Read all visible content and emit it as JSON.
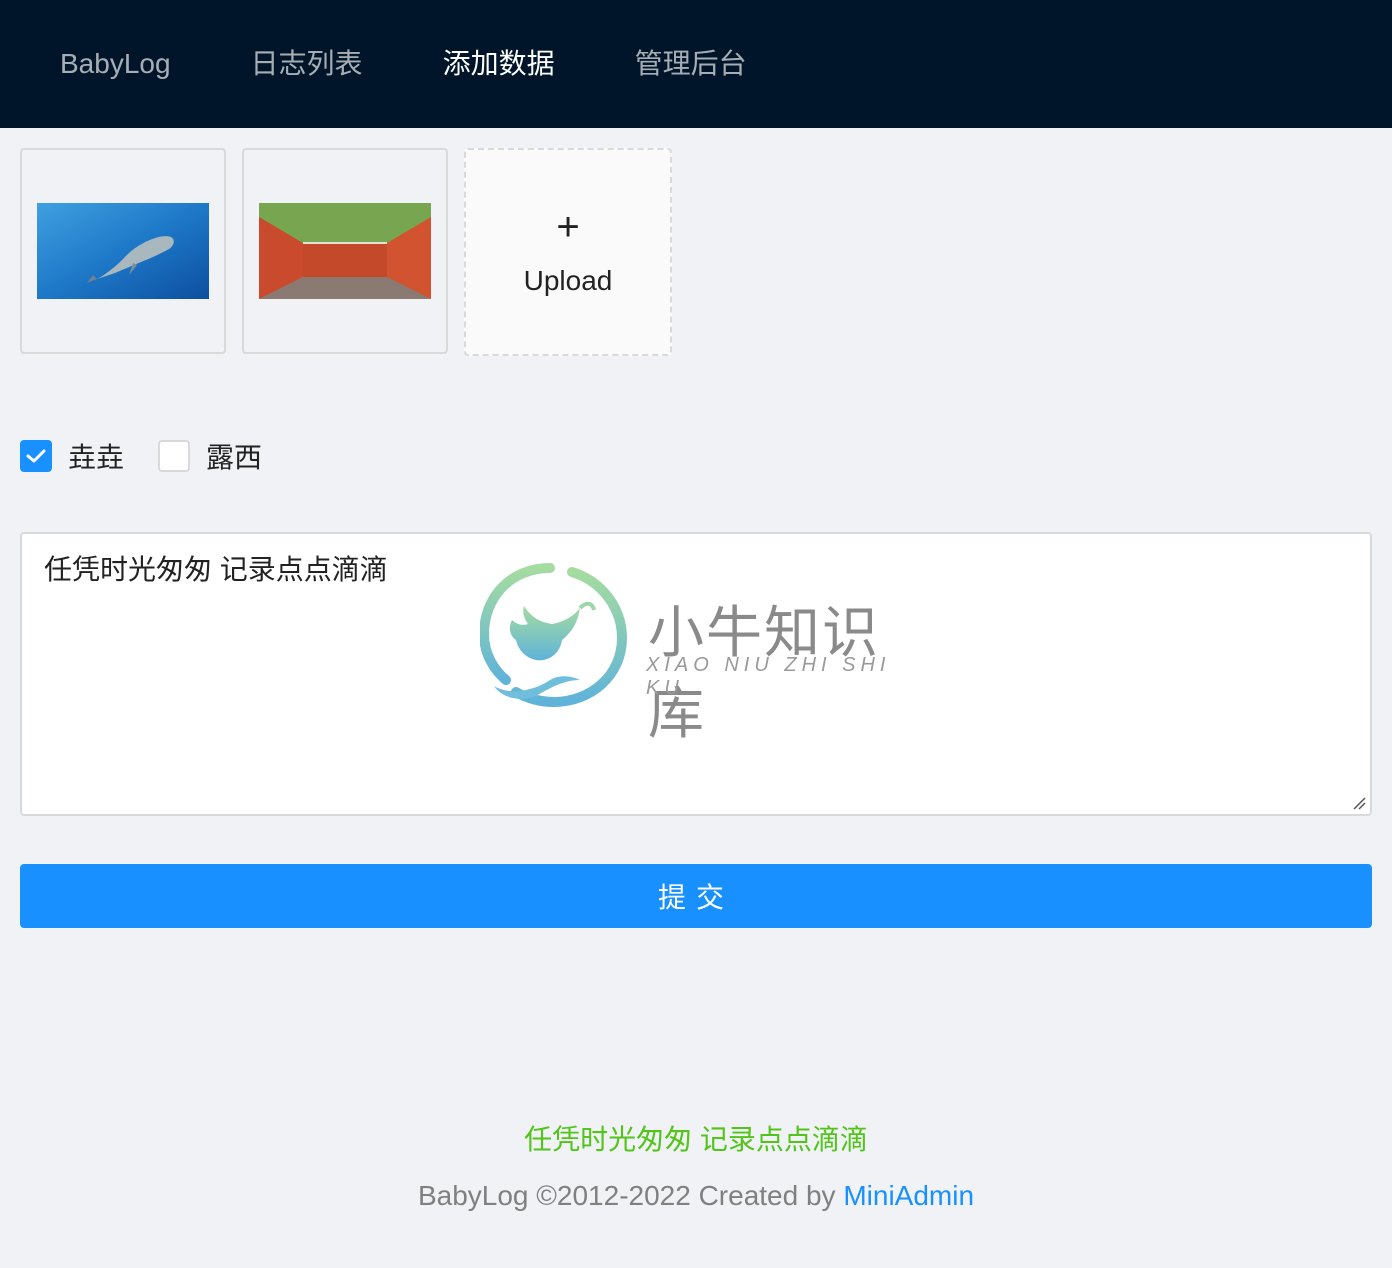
{
  "header": {
    "nav": [
      {
        "label": "BabyLog"
      },
      {
        "label": "日志列表"
      },
      {
        "label": "添加数据"
      },
      {
        "label": "管理后台"
      }
    ]
  },
  "upload": {
    "button_icon": "plus-icon",
    "button_label": "Upload"
  },
  "checkboxes": [
    {
      "label": "垚垚",
      "checked": true
    },
    {
      "label": "露西",
      "checked": false
    }
  ],
  "textarea": {
    "value": "任凭时光匆匆 记录点点滴滴"
  },
  "watermark": {
    "title": "小牛知识库",
    "subtitle": "XIAO NIU ZHI SHI KU"
  },
  "submit": {
    "label": "提交"
  },
  "footer": {
    "slogan": "任凭时光匆匆 记录点点滴滴",
    "copyright_prefix": "BabyLog ©2012-2022 Created by ",
    "link_label": "MiniAdmin"
  },
  "colors": {
    "header_bg": "#001529",
    "primary": "#1890ff",
    "slogan": "#52c41a"
  }
}
